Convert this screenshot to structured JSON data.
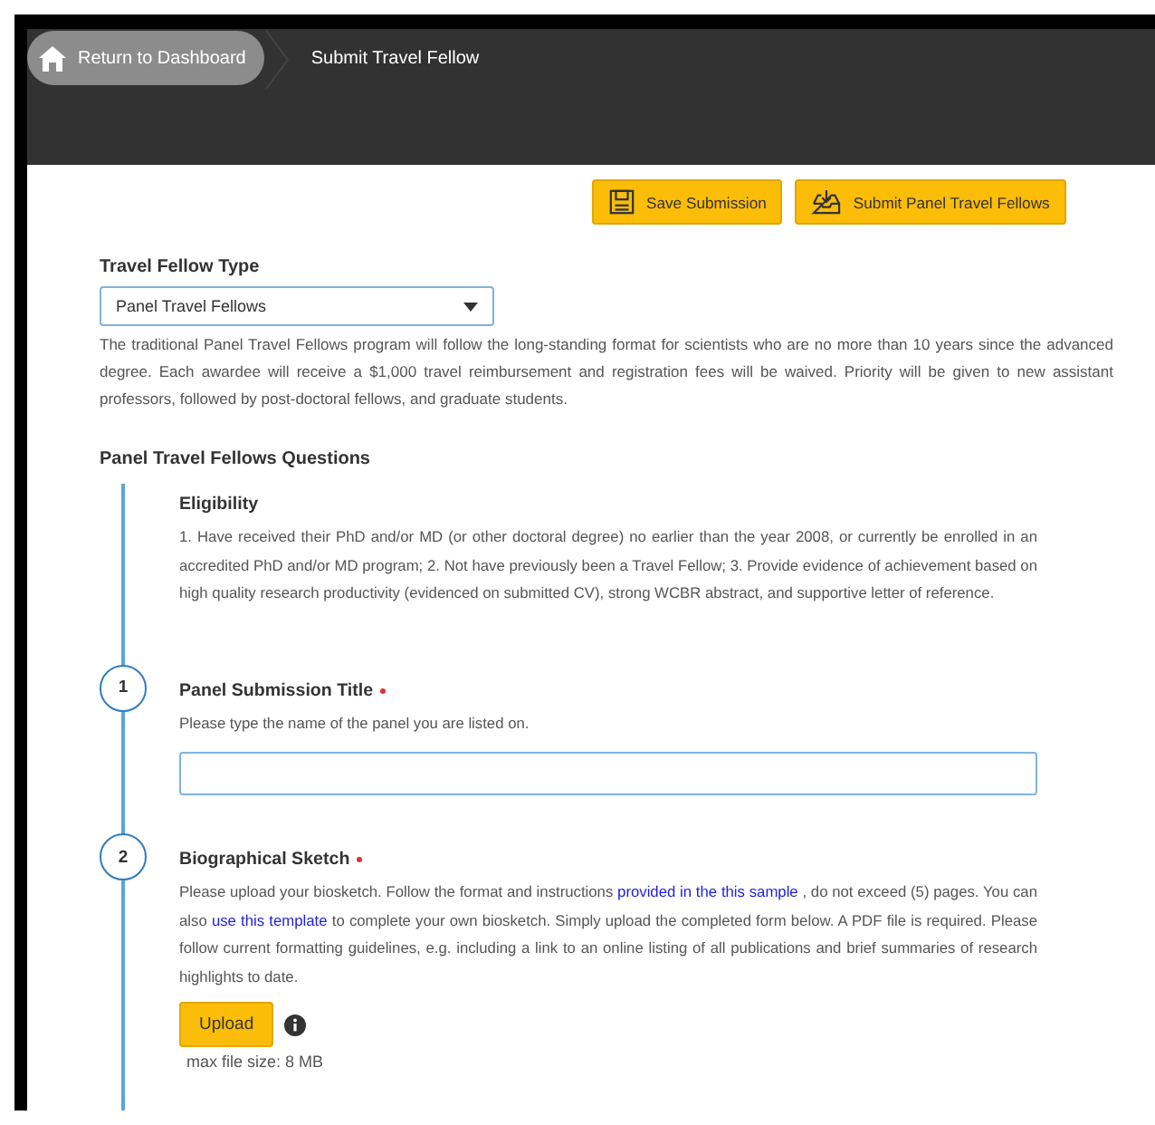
{
  "header": {
    "home_button": "Return to Dashboard",
    "breadcrumb": "Submit Travel Fellow"
  },
  "actions": [
    {
      "kind": "save",
      "label": "Save Submission"
    },
    {
      "kind": "submit",
      "label": "Submit Panel Travel Fellows"
    }
  ],
  "fellow_type": {
    "label": "Travel Fellow Type",
    "value": "Panel Travel Fellows",
    "description": "The traditional Panel Travel Fellows program will follow the long-standing format for scientists who are no more than 10 years since the advanced degree. Each awardee will receive a $1,000 travel reimbursement and registration fees will be waived. Priority will be given to new assistant professors, followed by post-doctoral fellows, and graduate students."
  },
  "questions": {
    "heading": "Panel Travel Fellows Questions",
    "intro": {
      "title": "Eligibility",
      "text": "1. Have received their PhD and/or MD (or other doctoral degree) no earlier than the year 2008, or currently be enrolled in an accredited PhD and/or MD program; 2. Not have previously been a Travel Fellow; 3. Provide evidence of achievement based on high quality research productivity (evidenced on submitted CV), strong WCBR abstract, and supportive letter of reference."
    },
    "items": [
      {
        "number": "1",
        "kind": "text",
        "title": "Panel Submission Title",
        "required": true,
        "help": [
          {
            "kind": "text",
            "text": "Please type the name of the panel you are listed on."
          }
        ]
      },
      {
        "number": "2",
        "kind": "upload",
        "title": "Biographical Sketch",
        "required": true,
        "help": [
          {
            "kind": "text",
            "text": "Please upload your biosketch. Follow the format and instructions "
          },
          {
            "kind": "link",
            "text": "provided in the this sample"
          },
          {
            "kind": "text",
            "text": " , do not exceed (5) pages. You can also "
          },
          {
            "kind": "link",
            "text": "use this template"
          },
          {
            "kind": "text",
            "text": " to complete your own biosketch. Simply upload the completed form below. A PDF file is required. Please follow current formatting guidelines, e.g. including a link to an online listing of all publications and brief summaries of research highlights to date."
          }
        ],
        "button": "Upload",
        "note": "max file size: 8 MB"
      }
    ]
  }
}
